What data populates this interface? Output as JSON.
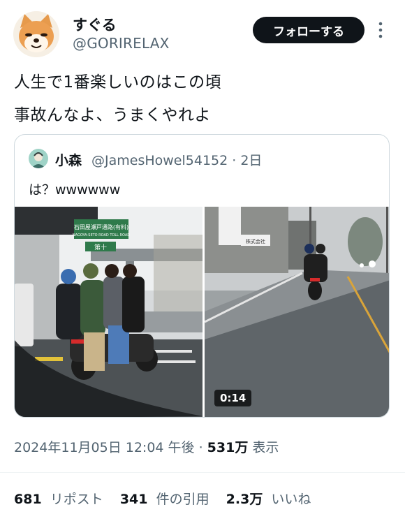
{
  "author": {
    "display_name": "すぐる",
    "handle": "@GORIRELAX",
    "avatar_icon": "shiba-dog-avatar-icon"
  },
  "follow_button": {
    "label": "フォローする"
  },
  "more_icon": "more-vertical-icon",
  "tweet": {
    "lines": [
      "人生で1番楽しいのはこの頃",
      "事故んなよ、うまくやれよ"
    ]
  },
  "quote": {
    "display_name": "小森",
    "handle_date": "@JamesHowel54152 · 2日",
    "text": "は？wwwwww",
    "left_photo_sign": "石田屋瀬戸通路(有料)",
    "left_photo_sign2": "NAGOYA-SETO ROAD TOLL ROAD",
    "left_photo_sign3": "第十",
    "right_photo_sign": "株式会社",
    "video_duration": "0:14"
  },
  "meta": {
    "datetime": "2024年11月05日 12:04 午後",
    "separator": " · ",
    "views_count": "531万",
    "views_label": "表示"
  },
  "stats": {
    "reposts_count": "681",
    "reposts_label": "リポスト",
    "quotes_count": "341",
    "quotes_label": "件の引用",
    "likes_count": "2.3万",
    "likes_label": "いいね"
  },
  "colors": {
    "text_primary": "#0f1419",
    "text_secondary": "#536471",
    "border": "#cfd9de",
    "button_bg": "#0f1419"
  }
}
